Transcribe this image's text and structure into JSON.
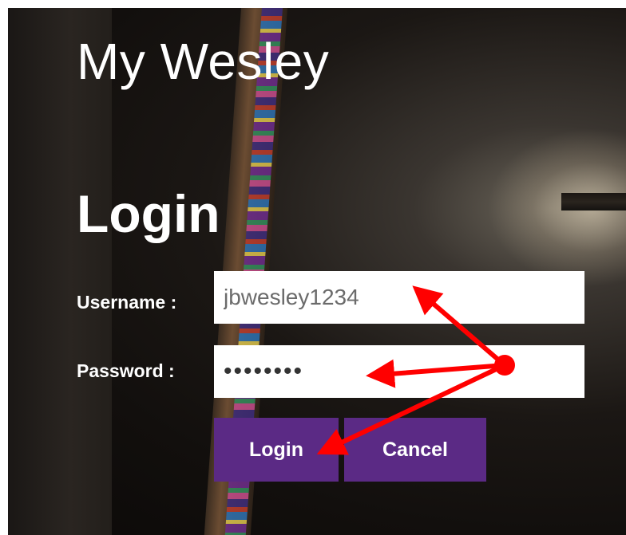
{
  "header": {
    "site_title": "My Wesley"
  },
  "main": {
    "page_title": "Login",
    "form": {
      "username_label": "Username :",
      "username_value": "jbwesley1234",
      "password_label": "Password :",
      "password_value": "wesley12",
      "login_label": "Login",
      "cancel_label": "Cancel"
    }
  },
  "colors": {
    "button_bg": "#5b2a85",
    "annotation_arrow": "#ff0000"
  },
  "icons": {
    "annotation": "red-pointer-arrows"
  }
}
